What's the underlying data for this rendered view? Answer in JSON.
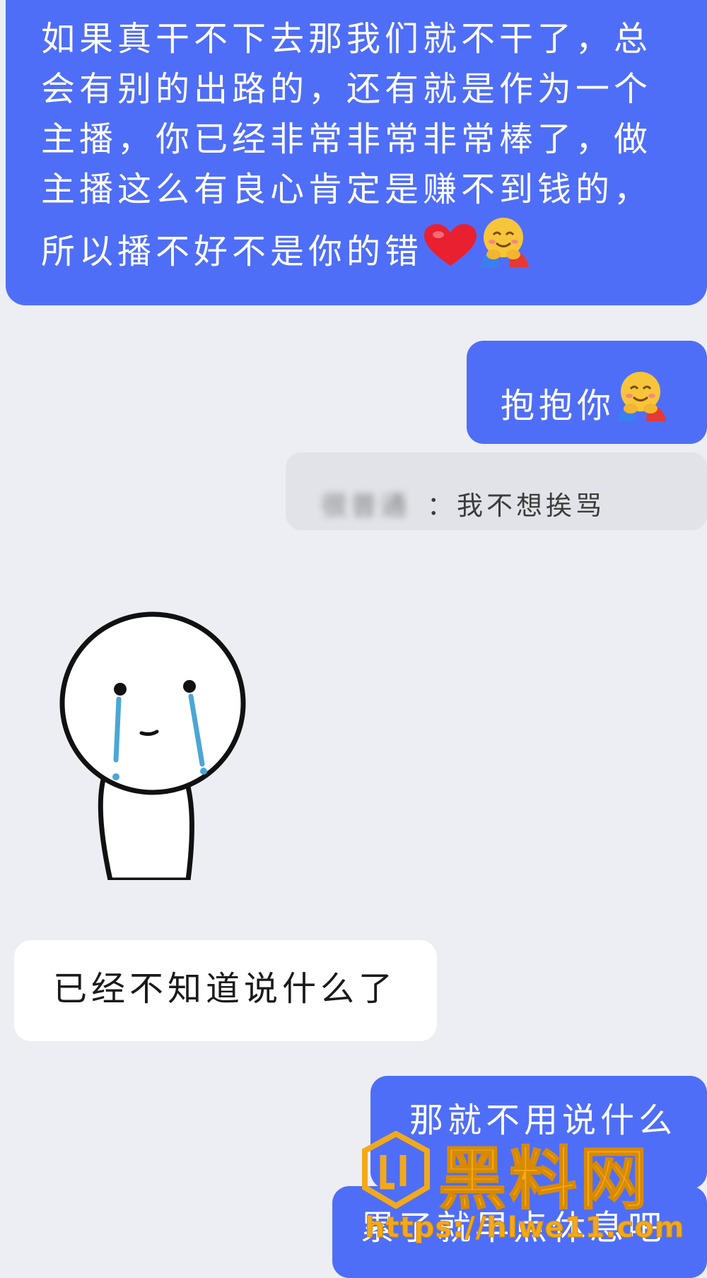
{
  "messages": {
    "top_outgoing": {
      "lines": [
        "如果真干不下去那我们就不干了，总",
        "会有别的出路的，还有就是作为一个",
        "主播，你已经非常非常非常棒了，做",
        "主播这么有良心肯定是赚不到钱的，",
        "所以播不好不是你的错"
      ],
      "trailing_emojis": [
        "heart-emoji",
        "hugging-face-emoji"
      ]
    },
    "hug_outgoing": {
      "text": "抱抱你",
      "emoji": "hugging-face-emoji"
    },
    "quote": {
      "sender_blurred": "很普通",
      "separator": "：",
      "text": "我不想挨骂"
    },
    "sticker": {
      "description_icon": "crying-stick-figure-sticker"
    },
    "dunno_incoming": {
      "text": "已经不知道说什么了"
    },
    "nothing_outgoing": {
      "text": "那就不用说什么"
    },
    "rest_outgoing": {
      "text": "累了就早点休息吧"
    }
  },
  "watermark": {
    "title": "黑料网",
    "url": "https://hlwe11.com"
  },
  "colors": {
    "outgoing_bubble": "#4f6ef7",
    "incoming_bubble": "#ffffff",
    "background": "#eceef3",
    "watermark": "#f2a91a"
  }
}
